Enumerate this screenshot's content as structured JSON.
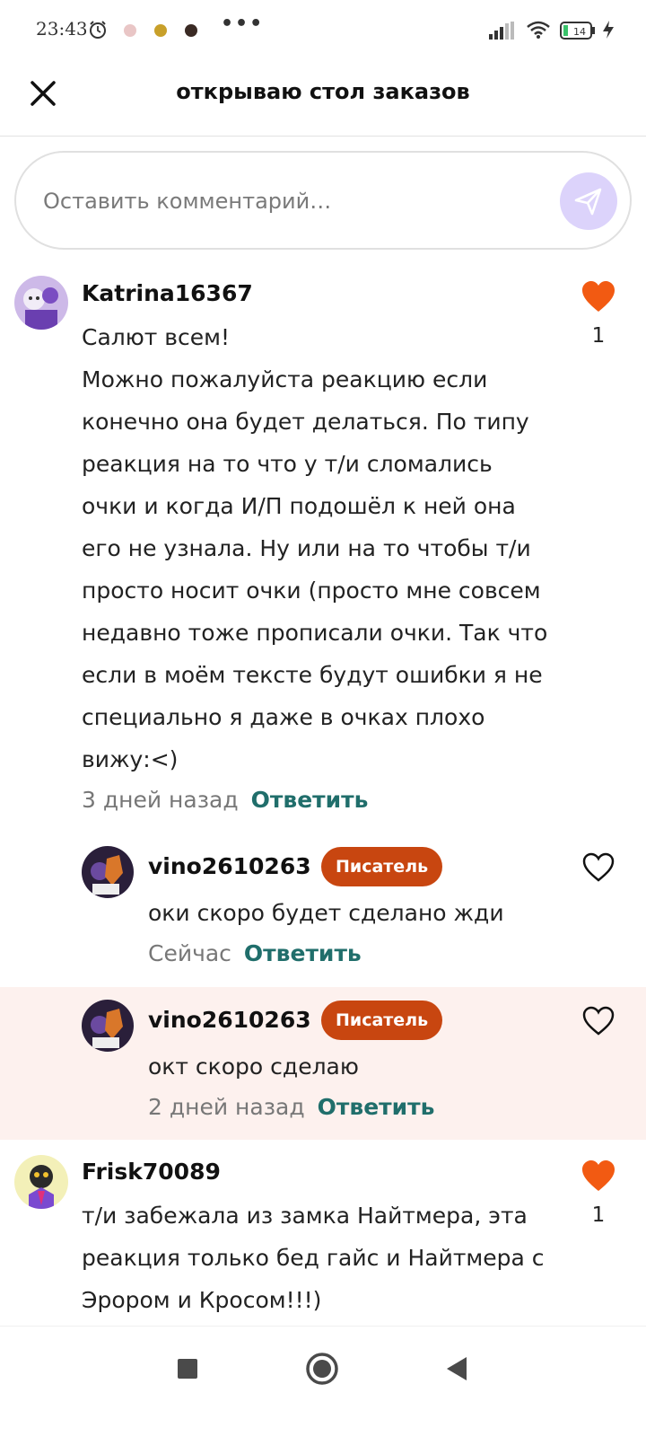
{
  "status_bar": {
    "time": "23:43",
    "battery_level": "14",
    "icons": [
      "alarm-icon",
      "app-notification-icon",
      "app-notification-icon",
      "app-notification-icon",
      "more-dots-icon",
      "signal-icon",
      "wifi-icon",
      "battery-icon",
      "charging-icon"
    ],
    "more_dots": "•••"
  },
  "header": {
    "title": "открываю стол заказов",
    "close_icon": "close-icon"
  },
  "comment_input": {
    "placeholder": "Оставить комментарий…",
    "send_icon": "send-icon",
    "send_bg_color": "#dcd3fb"
  },
  "colors": {
    "accent_link": "#206e6b",
    "like_active": "#f25a12",
    "badge": "#c84610",
    "highlight": "#fdf1ee"
  },
  "comments": [
    {
      "username": "Katrina16367",
      "text": "Салют всем!\nМожно пожалуйста реакцию если конечно она будет делаться. По типу реакция на то что у т/и сломались очки и когда И/П подошёл к ней она его не узнала. Ну или на то чтобы т/и просто носит очки (просто мне совсем недавно тоже прописали очки. Так что если в моём тексте будут ошибки я не специально я даже в очках плохо вижу:<)",
      "time": "3 дней назад",
      "reply_label": "Ответить",
      "likes": "1",
      "liked": true
    },
    {
      "username": "vino2610263",
      "badge": "Писатель",
      "text": "оки скоро будет сделано жди",
      "time": "Сейчас",
      "reply_label": "Ответить",
      "liked": false
    },
    {
      "username": "vino2610263",
      "badge": "Писатель",
      "text": "окт скоро сделаю",
      "time": "2 дней назад",
      "reply_label": "Ответить",
      "liked": false,
      "highlighted": true
    },
    {
      "username": "Frisk70089",
      "text": "т/и забежала из замка Найтмера, эта реакция только бед гайс и Найтмера с Эрором и Кросом!!!)",
      "likes": "1",
      "liked": true
    }
  ],
  "nav_bar": {
    "icons": [
      "recents-icon",
      "home-icon",
      "back-icon"
    ]
  }
}
